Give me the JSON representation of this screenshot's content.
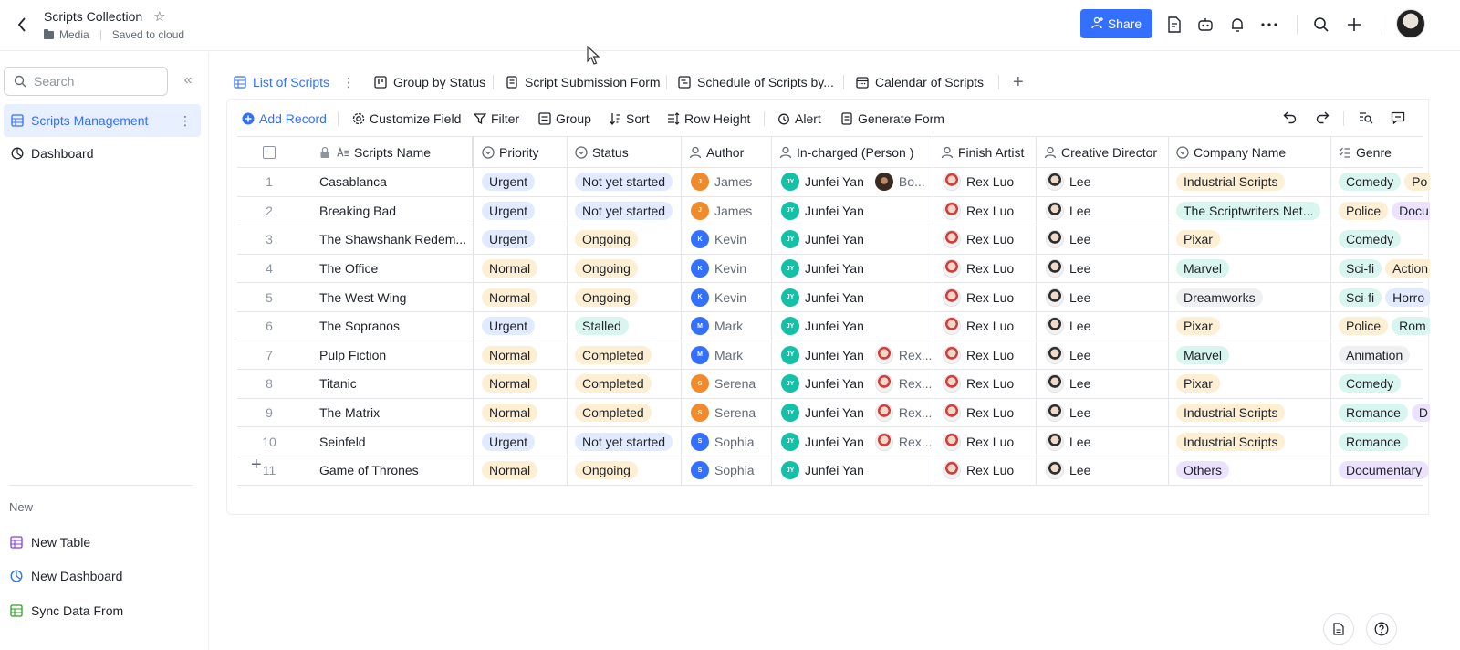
{
  "header": {
    "title": "Scripts Collection",
    "folder": "Media",
    "save_status": "Saved to cloud",
    "share_label": "Share"
  },
  "sidebar": {
    "search_placeholder": "Search",
    "items": [
      {
        "label": "Scripts Management",
        "icon": "table-icon",
        "active": true
      },
      {
        "label": "Dashboard",
        "icon": "dashboard-icon",
        "active": false
      }
    ],
    "new_section_label": "New",
    "new_items": [
      {
        "label": "New Table",
        "icon": "table-icon"
      },
      {
        "label": "New Dashboard",
        "icon": "dashboard-icon"
      },
      {
        "label": "Sync Data From",
        "icon": "sync-icon"
      }
    ]
  },
  "tabs": [
    {
      "label": "List of Scripts",
      "icon": "grid-view-icon",
      "active": true
    },
    {
      "label": "Group by Status",
      "icon": "kanban-icon",
      "active": false
    },
    {
      "label": "Script Submission Form",
      "icon": "form-icon",
      "active": false
    },
    {
      "label": "Schedule of Scripts by...",
      "icon": "gantt-icon",
      "active": false
    },
    {
      "label": "Calendar of Scripts",
      "icon": "calendar-icon",
      "active": false
    }
  ],
  "toolbar": {
    "add_record": "Add Record",
    "customize_field": "Customize Field",
    "filter": "Filter",
    "group": "Group",
    "sort": "Sort",
    "row_height": "Row Height",
    "alert": "Alert",
    "generate_form": "Generate Form"
  },
  "columns": [
    {
      "label": "Scripts Name",
      "icon": "text-field-icon"
    },
    {
      "label": "Priority",
      "icon": "select-field-icon"
    },
    {
      "label": "Status",
      "icon": "select-field-icon"
    },
    {
      "label": "Author",
      "icon": "person-field-icon"
    },
    {
      "label": "In-charged (Person )",
      "icon": "person-field-icon"
    },
    {
      "label": "Finish Artist",
      "icon": "person-field-icon"
    },
    {
      "label": "Creative Director",
      "icon": "person-field-icon"
    },
    {
      "label": "Company Name",
      "icon": "select-field-icon"
    },
    {
      "label": "Genre",
      "icon": "multi-select-field-icon"
    }
  ],
  "rows": [
    {
      "num": "1",
      "name": "Casablanca",
      "priority": "Urgent",
      "status": "Not yet started",
      "author": "James",
      "author_initial": "J",
      "incharged": [
        "Junfei Yan",
        "Bo..."
      ],
      "finish": "Rex Luo",
      "director": "Lee",
      "company": "Industrial Scripts",
      "genre": [
        "Comedy",
        "Po"
      ]
    },
    {
      "num": "2",
      "name": "Breaking Bad",
      "priority": "Urgent",
      "status": "Not yet started",
      "author": "James",
      "author_initial": "J",
      "incharged": [
        "Junfei Yan"
      ],
      "finish": "Rex Luo",
      "director": "Lee",
      "company": "The Scriptwriters Net...",
      "genre": [
        "Police",
        "Docu"
      ]
    },
    {
      "num": "3",
      "name": "The Shawshank Redem...",
      "priority": "Urgent",
      "status": "Ongoing",
      "author": "Kevin",
      "author_initial": "K",
      "incharged": [
        "Junfei Yan"
      ],
      "finish": "Rex Luo",
      "director": "Lee",
      "company": "Pixar",
      "genre": [
        "Comedy"
      ]
    },
    {
      "num": "4",
      "name": "The Office",
      "priority": "Normal",
      "status": "Ongoing",
      "author": "Kevin",
      "author_initial": "K",
      "incharged": [
        "Junfei Yan"
      ],
      "finish": "Rex Luo",
      "director": "Lee",
      "company": "Marvel",
      "genre": [
        "Sci-fi",
        "Action"
      ]
    },
    {
      "num": "5",
      "name": "The West Wing",
      "priority": "Normal",
      "status": "Ongoing",
      "author": "Kevin",
      "author_initial": "K",
      "incharged": [
        "Junfei Yan"
      ],
      "finish": "Rex Luo",
      "director": "Lee",
      "company": "Dreamworks",
      "genre": [
        "Sci-fi",
        "Horro"
      ]
    },
    {
      "num": "6",
      "name": "The Sopranos",
      "priority": "Urgent",
      "status": "Stalled",
      "author": "Mark",
      "author_initial": "M",
      "incharged": [
        "Junfei Yan"
      ],
      "finish": "Rex Luo",
      "director": "Lee",
      "company": "Pixar",
      "genre": [
        "Police",
        "Rom"
      ]
    },
    {
      "num": "7",
      "name": "Pulp Fiction",
      "priority": "Normal",
      "status": "Completed",
      "author": "Mark",
      "author_initial": "M",
      "incharged": [
        "Junfei Yan",
        "Rex..."
      ],
      "finish": "Rex Luo",
      "director": "Lee",
      "company": "Marvel",
      "genre": [
        "Animation"
      ]
    },
    {
      "num": "8",
      "name": "Titanic",
      "priority": "Normal",
      "status": "Completed",
      "author": "Serena",
      "author_initial": "S",
      "incharged": [
        "Junfei Yan",
        "Rex..."
      ],
      "finish": "Rex Luo",
      "director": "Lee",
      "company": "Pixar",
      "genre": [
        "Comedy"
      ]
    },
    {
      "num": "9",
      "name": "The Matrix",
      "priority": "Normal",
      "status": "Completed",
      "author": "Serena",
      "author_initial": "S",
      "incharged": [
        "Junfei Yan",
        "Rex..."
      ],
      "finish": "Rex Luo",
      "director": "Lee",
      "company": "Industrial Scripts",
      "genre": [
        "Romance",
        "D"
      ]
    },
    {
      "num": "10",
      "name": "Seinfeld",
      "priority": "Urgent",
      "status": "Not yet started",
      "author": "Sophia",
      "author_initial": "S",
      "incharged": [
        "Junfei Yan",
        "Rex..."
      ],
      "finish": "Rex Luo",
      "director": "Lee",
      "company": "Industrial Scripts",
      "genre": [
        "Romance"
      ]
    },
    {
      "num": "11",
      "name": "Game of Thrones",
      "priority": "Normal",
      "status": "Ongoing",
      "author": "Sophia",
      "author_initial": "S",
      "incharged": [
        "Junfei Yan"
      ],
      "finish": "Rex Luo",
      "director": "Lee",
      "company": "Others",
      "genre": [
        "Documentary"
      ]
    }
  ],
  "initials": {
    "junfei": "JY"
  },
  "colors": {
    "accent": "#3370ff",
    "tag_blue": "#e1eaff",
    "tag_orange": "#fdefd4",
    "tag_green": "#d9f5f0",
    "tag_purple": "#ece2fe",
    "tag_grey": "#eff0f1",
    "author_orange": "#f08a2b",
    "author_blue": "#3370ff",
    "junfei_teal": "#14c0a6"
  }
}
